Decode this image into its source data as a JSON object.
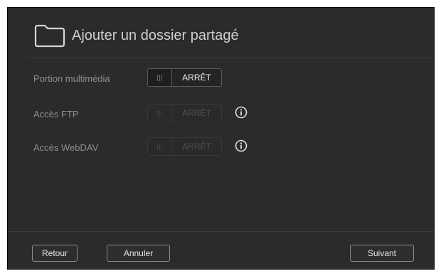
{
  "dialog": {
    "title": "Ajouter un dossier partagé",
    "icon": "folder-icon"
  },
  "rows": [
    {
      "label": "Portion multimédia",
      "toggle": "ARRÊT",
      "enabled": true
    },
    {
      "label": "Accès FTP",
      "toggle": "ARRÊT",
      "enabled": false,
      "info_icon": "info-icon"
    },
    {
      "label": "Accès WebDAV",
      "toggle": "ARRÊT",
      "enabled": false,
      "info_icon": "info-icon"
    }
  ],
  "footer": {
    "back_label": "Retour",
    "cancel_label": "Annuler",
    "next_label": "Suivant"
  },
  "colors": {
    "background": "#2b2b2b",
    "border": "#000000",
    "text_primary": "#cfcfcf",
    "text_label": "#8f8f8f",
    "button_border": "#8a8a8a"
  }
}
